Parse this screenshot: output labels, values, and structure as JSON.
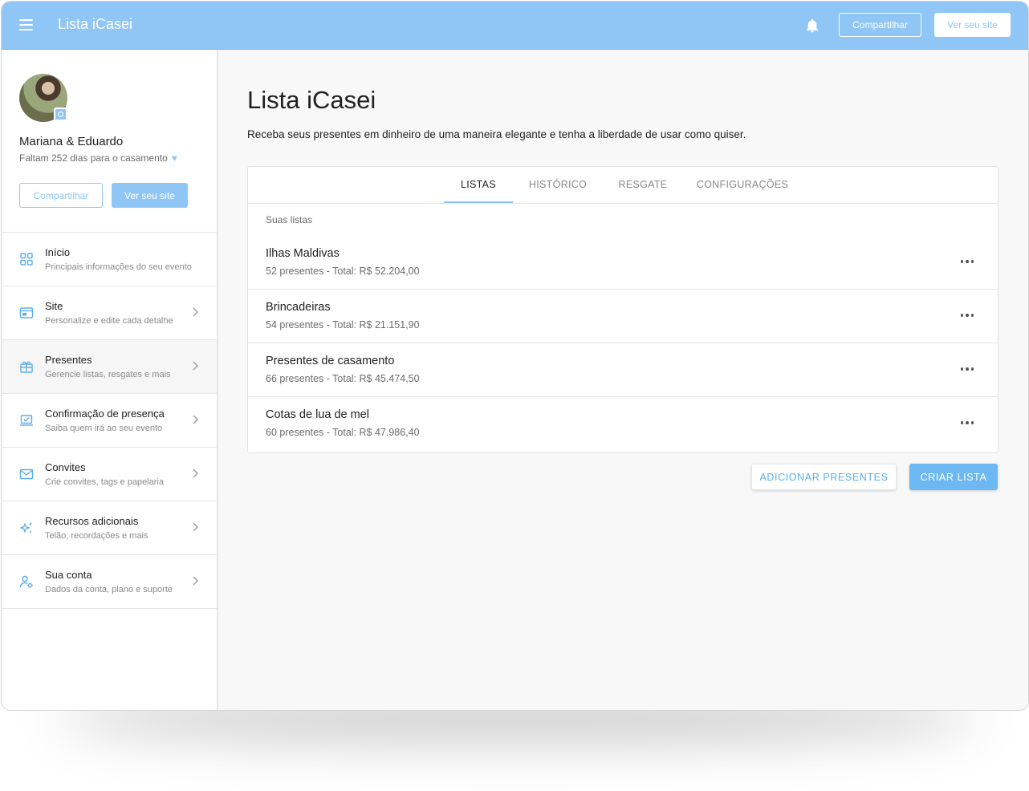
{
  "topbar": {
    "app_title": "Lista iCasei",
    "share_label": "Compartilhar",
    "view_site_label": "Ver seu site"
  },
  "profile": {
    "couple": "Mariana & Eduardo",
    "countdown": "Faltam 252 dias para o casamento",
    "share_label": "Compartilhar",
    "view_site_label": "Ver seu site"
  },
  "sidebar": {
    "items": [
      {
        "title": "Início",
        "subtitle": "Principais informações do seu evento",
        "icon": "grid-icon"
      },
      {
        "title": "Site",
        "subtitle": "Personalize e edite cada detalhe",
        "icon": "browser-icon"
      },
      {
        "title": "Presentes",
        "subtitle": "Gerencie listas, resgates e mais",
        "icon": "gift-icon"
      },
      {
        "title": "Confirmação de presença",
        "subtitle": "Saiba quem irá ao seu evento",
        "icon": "laptop-check-icon"
      },
      {
        "title": "Convites",
        "subtitle": "Crie convites, tags e papelaria",
        "icon": "envelope-icon"
      },
      {
        "title": "Recursos adicionais",
        "subtitle": "Telão, recordações e mais",
        "icon": "sparkles-icon"
      },
      {
        "title": "Sua conta",
        "subtitle": "Dados da conta, plano e suporte",
        "icon": "user-gear-icon"
      }
    ]
  },
  "main": {
    "title": "Lista iCasei",
    "description": "Receba seus presentes em dinheiro de uma maneira elegante e tenha a liberdade de usar como quiser.",
    "tabs": [
      {
        "label": "LISTAS"
      },
      {
        "label": "HISTÓRICO"
      },
      {
        "label": "RESGATE"
      },
      {
        "label": "CONFIGURAÇÕES"
      }
    ],
    "section_label": "Suas listas",
    "lists": [
      {
        "name": "Ilhas Maldivas",
        "summary": "52 presentes - Total: R$ 52.204,00"
      },
      {
        "name": "Brincadeiras",
        "summary": "54 presentes - Total: R$ 21.151,90"
      },
      {
        "name": "Presentes de casamento",
        "summary": "66 presentes - Total: R$ 45.474,50"
      },
      {
        "name": "Cotas de lua de mel",
        "summary": "60 presentes - Total: R$ 47.986,40"
      }
    ],
    "add_gifts_label": "ADICIONAR PRESENTES",
    "create_list_label": "CRIAR LISTA"
  },
  "colors": {
    "accent": "#8fc6f6",
    "button_primary": "#6bb8f2"
  }
}
